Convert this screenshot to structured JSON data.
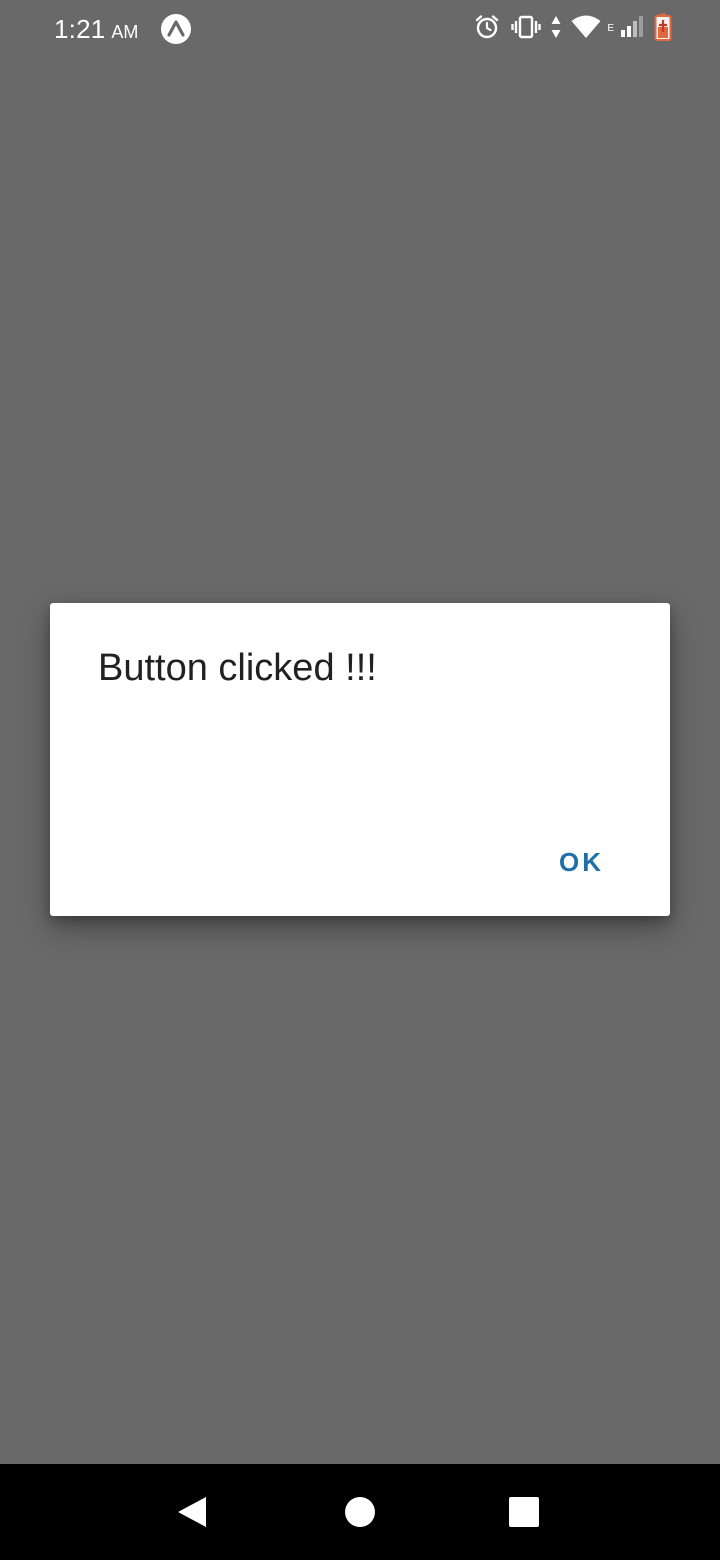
{
  "status_bar": {
    "time": "1:21",
    "ampm": "AM",
    "network_type": "E",
    "icons": [
      "expo-icon",
      "alarm-icon",
      "vibrate-icon",
      "data-arrows-icon",
      "wifi-icon",
      "cell-signal-icon",
      "battery-icon"
    ]
  },
  "dialog": {
    "title": "Button clicked !!!",
    "ok_label": "OK",
    "accent_color": "#1f6fa8"
  },
  "nav_bar": {
    "icons": [
      "back-icon",
      "home-icon",
      "recents-icon"
    ]
  },
  "colors": {
    "scrim": "#696969",
    "dialog_bg": "#ffffff",
    "nav_bg": "#000000"
  }
}
